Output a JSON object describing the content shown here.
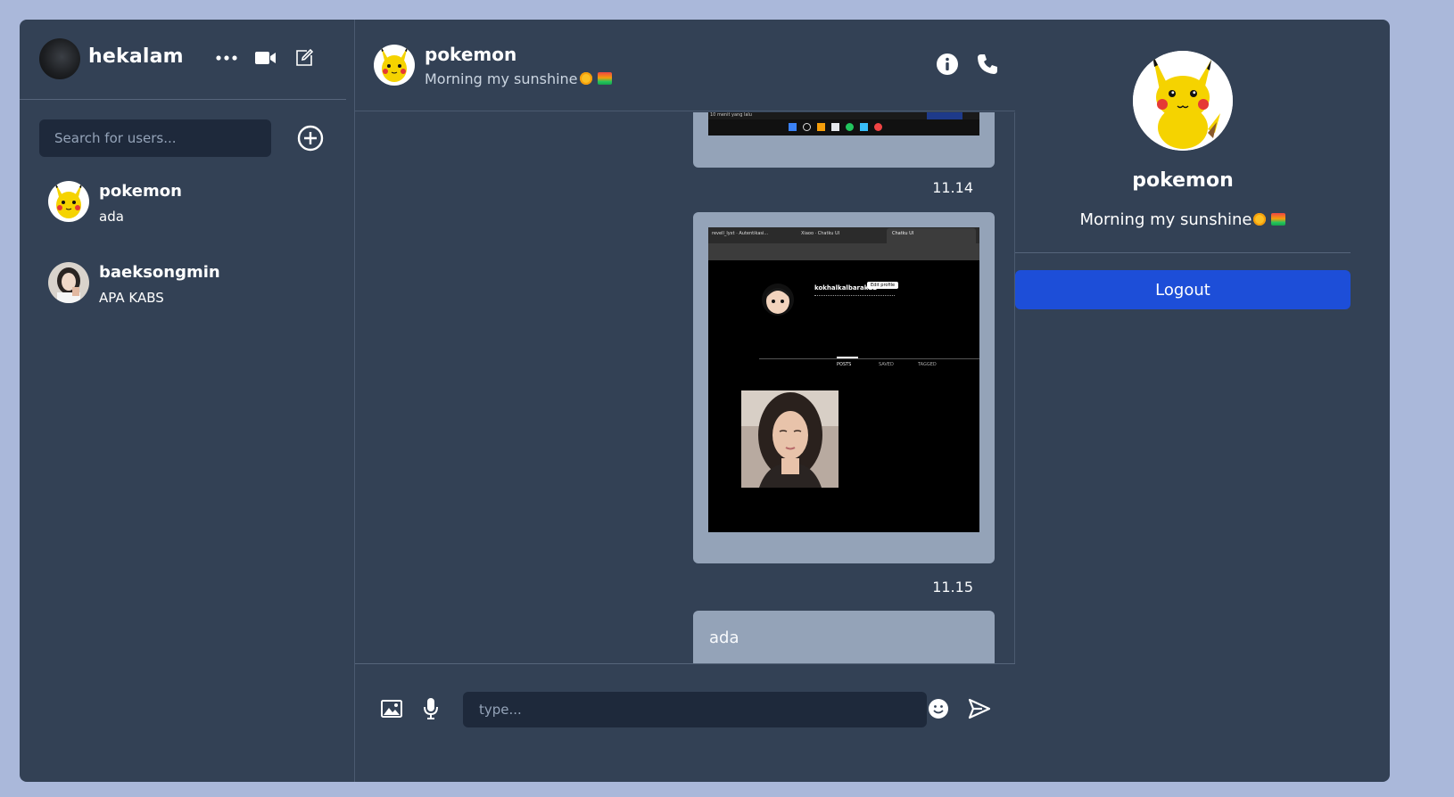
{
  "sidebar": {
    "username": "hekalam",
    "search_placeholder": "Search for users...",
    "conversations": [
      {
        "name": "pokemon",
        "last_message": "ada"
      },
      {
        "name": "baeksongmin",
        "last_message": "APA KABS"
      }
    ]
  },
  "chat": {
    "contact_name": "pokemon",
    "contact_status": "Morning my sunshine",
    "messages": [
      {
        "type": "image",
        "time": "11.14"
      },
      {
        "type": "image",
        "time": "11.15"
      },
      {
        "type": "text",
        "text": "ada"
      }
    ],
    "screenshot_texts": {
      "top_bar": "10 menit yang lalu",
      "tab1": "revell_lyxt · Autentikasi...",
      "tab2": "Xiaoo · Chatku UI",
      "tab3": "Chatku UI",
      "profile_handle": "kokhalkalbarak12",
      "edit_profile": "Edit profile",
      "posts_tab": "POSTS",
      "saved_tab": "SAVED",
      "tagged_tab": "TAGGED"
    },
    "input_placeholder": "type..."
  },
  "profile": {
    "name": "pokemon",
    "status": "Morning my sunshine",
    "logout_label": "Logout"
  },
  "colors": {
    "page_bg": "#aab8da",
    "panel_bg": "#334155",
    "input_bg": "#1e293b",
    "bubble_bg": "#94a3b8",
    "logout_bg": "#1d4ed8"
  }
}
